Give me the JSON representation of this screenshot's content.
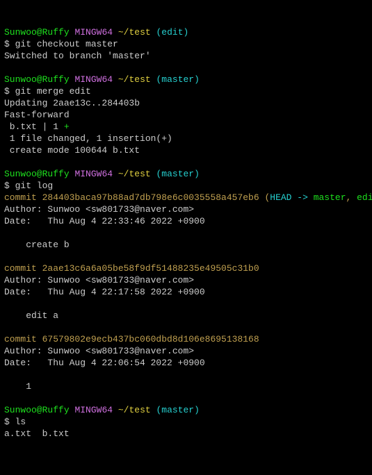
{
  "blocks": {
    "b1": {
      "user": "Sunwoo@Ruffy",
      "sys": "MINGW64",
      "path": "~/test",
      "branch": "(edit)",
      "prompt": "$ ",
      "cmd": "git checkout master",
      "out1": "Switched to branch 'master'"
    },
    "b2": {
      "user": "Sunwoo@Ruffy",
      "sys": "MINGW64",
      "path": "~/test",
      "branch": "(master)",
      "prompt": "$ ",
      "cmd": "git merge edit",
      "o1": "Updating 2aae13c..284403b",
      "o2": "Fast-forward",
      "o3a": " b.txt | 1 ",
      "o3b": "+",
      "o4": " 1 file changed, 1 insertion(+)",
      "o5": " create mode 100644 b.txt"
    },
    "b3": {
      "user": "Sunwoo@Ruffy",
      "sys": "MINGW64",
      "path": "~/test",
      "branch": "(master)",
      "prompt": "$ ",
      "cmd": "git log"
    },
    "c1": {
      "line1a": "commit 284403baca97b88ad7db798e6c0035558a457eb6 (",
      "head": "HEAD -> ",
      "master": "master",
      "sep": ", ",
      "edit": "edit",
      "close": ")",
      "author": "Author: Sunwoo <sw801733@naver.com>",
      "date": "Date:   Thu Aug 4 22:33:46 2022 +0900",
      "msg": "    create b"
    },
    "c2": {
      "line1": "commit 2aae13c6a6a05be58f9df51488235e49505c31b0",
      "author": "Author: Sunwoo <sw801733@naver.com>",
      "date": "Date:   Thu Aug 4 22:17:58 2022 +0900",
      "msg": "    edit a"
    },
    "c3": {
      "line1": "commit 67579802e9ecb437bc060dbd8d106e8695138168",
      "author": "Author: Sunwoo <sw801733@naver.com>",
      "date": "Date:   Thu Aug 4 22:06:54 2022 +0900",
      "msg": "    1"
    },
    "b4": {
      "user": "Sunwoo@Ruffy",
      "sys": "MINGW64",
      "path": "~/test",
      "branch": "(master)",
      "prompt": "$ ",
      "cmd": "ls",
      "out": "a.txt  b.txt"
    }
  }
}
